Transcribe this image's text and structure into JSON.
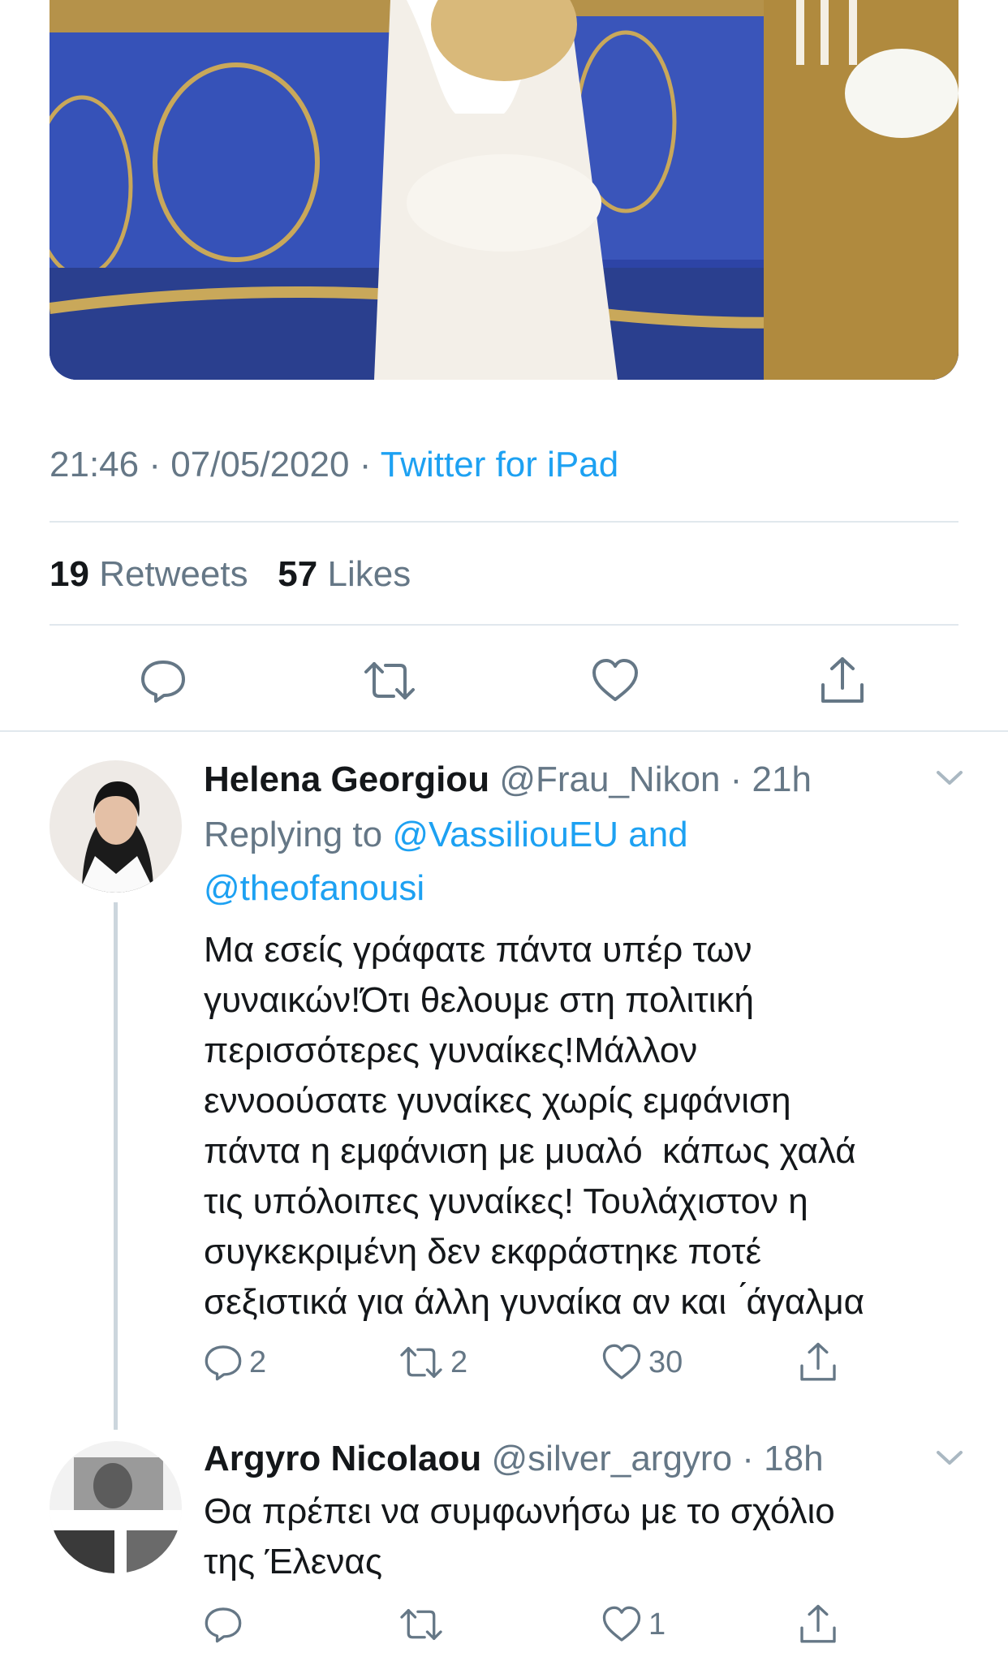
{
  "tweet": {
    "time": "21:46",
    "date": "07/05/2020",
    "source": "Twitter for iPad",
    "retweets_count": "19",
    "retweets_label": "Retweets",
    "likes_count": "57",
    "likes_label": "Likes"
  },
  "replies": [
    {
      "name": "Helena Georgiou",
      "handle": "@Frau_Nikon",
      "time": "21h",
      "replying_prefix": "Replying to",
      "mention1": "@VassiliouEU",
      "and": "and",
      "mention2": "@theofanousi",
      "text": "Μα εσείς γράφατε πάντα υπέρ των\nγυναικών!Ότι θελουμε στη πολιτική\nπερισσότερες γυναίκες!Μάλλον\nεννοούσατε γυναίκες χωρίς εμφάνιση\nπάντα η εμφάνιση με μυαλό  κάπως χαλά\nτις υπόλοιπες γυναίκες! Τουλάχιστον η\nσυγκεκριμένη δεν εκφράστηκε ποτέ\nσεξιστικά για άλλη γυναίκα αν και  ́άγαλμα",
      "reply_count": "2",
      "retweet_count": "2",
      "like_count": "30"
    },
    {
      "name": "Argyro Nicolaou",
      "handle": "@silver_argyro",
      "time": "18h",
      "text": "Θα πρέπει να συμφωνήσω με το σχόλιο\nτης Έλενας",
      "like_count": "1"
    }
  ],
  "colors": {
    "accent": "#1da1f2",
    "secondary_text": "#657786",
    "divider": "#e1e8ed"
  },
  "icons": [
    "reply-icon",
    "retweet-icon",
    "like-icon",
    "share-icon",
    "chevron-down-icon"
  ]
}
